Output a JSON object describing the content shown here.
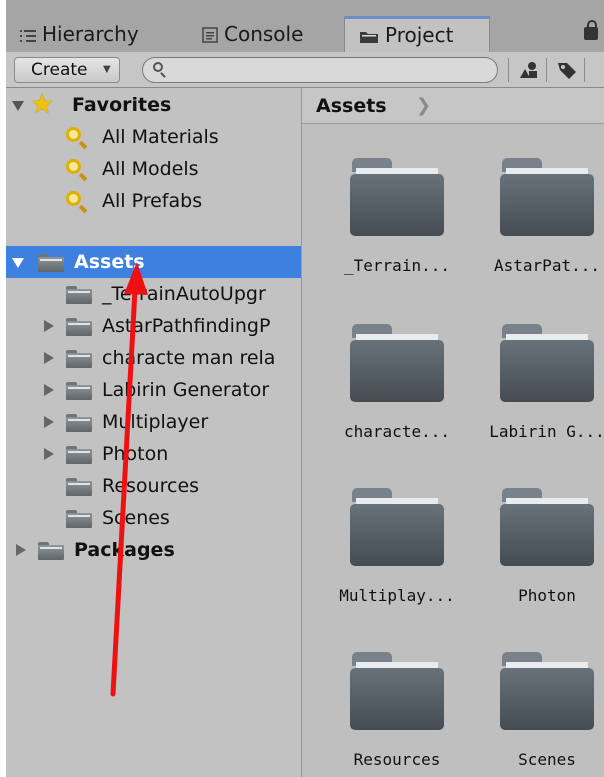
{
  "tabs": [
    {
      "label": "Hierarchy",
      "icon": "hierarchy-icon"
    },
    {
      "label": "Console",
      "icon": "console-icon"
    },
    {
      "label": "Project",
      "icon": "folder-icon",
      "active": true
    }
  ],
  "toolbar": {
    "create_label": "Create",
    "search_placeholder": "",
    "buttons": [
      "filter-by-type-icon",
      "filter-by-label-icon"
    ]
  },
  "favorites": {
    "label": "Favorites",
    "items": [
      "All Materials",
      "All Models",
      "All Prefabs"
    ]
  },
  "assets_tree": {
    "label": "Assets",
    "children": [
      {
        "label": "_TerrainAutoUpgr",
        "has_children": false
      },
      {
        "label": "AstarPathfindingP",
        "has_children": true
      },
      {
        "label": "characte man rela",
        "has_children": true
      },
      {
        "label": "Labirin Generator",
        "has_children": true
      },
      {
        "label": "Multiplayer",
        "has_children": true
      },
      {
        "label": "Photon",
        "has_children": true
      },
      {
        "label": "Resources",
        "has_children": false
      },
      {
        "label": "Scenes",
        "has_children": false
      }
    ]
  },
  "packages": {
    "label": "Packages"
  },
  "breadcrumb": {
    "label": "Assets"
  },
  "grid_items": [
    {
      "label": "_Terrain..."
    },
    {
      "label": "AstarPat..."
    },
    {
      "label": "characte..."
    },
    {
      "label": "Labirin G..."
    },
    {
      "label": "Multiplay..."
    },
    {
      "label": "Photon"
    },
    {
      "label": "Resources"
    },
    {
      "label": "Scenes"
    }
  ],
  "colors": {
    "selection": "#3d80df",
    "annotation_arrow": "#ee1111",
    "folder": "#5e666a",
    "star": "#f2c200"
  }
}
